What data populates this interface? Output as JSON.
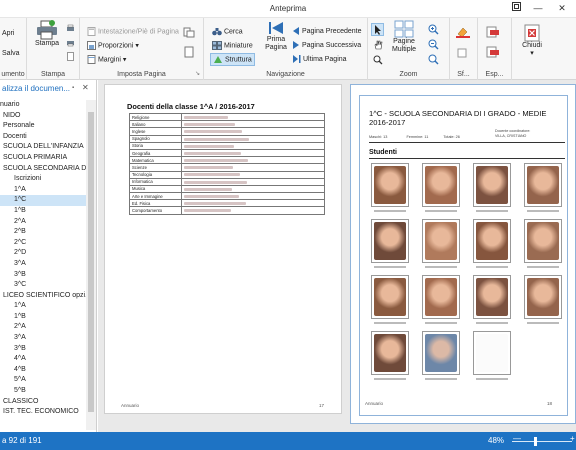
{
  "window": {
    "title": "Anteprima",
    "restore_icon": "restore-icon",
    "minimize": "—",
    "close": "✕"
  },
  "ribbon": {
    "documento": {
      "apri": "Apri",
      "salva": "Salva",
      "label": "umento"
    },
    "stampa": {
      "stampa": "Stampa",
      "label": "Stampa"
    },
    "imposta": {
      "intestazione": "Intestazione/Piè di Pagina",
      "proporzioni": "Proporzioni",
      "margini": "Margini",
      "label": "Imposta Pagina"
    },
    "navigazione": {
      "cerca": "Cerca",
      "miniature": "Miniature",
      "struttura": "Struttura",
      "prima_pagina": "Prima\nPagina",
      "pagina_precedente": "Pagina Precedente",
      "pagina_successiva": "Pagina Successiva",
      "ultima_pagina": "Ultima Pagina",
      "label": "Navigazione"
    },
    "zoom": {
      "pagine_multiple": "Pagine\nMultiple",
      "label": "Zoom"
    },
    "sf": {
      "label": "Sf..."
    },
    "esp": {
      "label": "Esp..."
    },
    "chiudi": {
      "chiudi": "Chiudi"
    }
  },
  "sidebar": {
    "title": "alizza il documen...",
    "items": [
      {
        "label": "nuario",
        "indent": 0
      },
      {
        "label": "NIDO",
        "indent": 1
      },
      {
        "label": "Personale",
        "indent": 1
      },
      {
        "label": "Docenti",
        "indent": 1
      },
      {
        "label": "SCUOLA DELL'INFANZIA",
        "indent": 1
      },
      {
        "label": "SCUOLA PRIMARIA",
        "indent": 1
      },
      {
        "label": "SCUOLA SECONDARIA D...",
        "indent": 1
      },
      {
        "label": "Iscrizioni",
        "indent": 2
      },
      {
        "label": "1^A",
        "indent": 2
      },
      {
        "label": "1^C",
        "indent": 2,
        "selected": true
      },
      {
        "label": "1^B",
        "indent": 2
      },
      {
        "label": "2^A",
        "indent": 2
      },
      {
        "label": "2^B",
        "indent": 2
      },
      {
        "label": "2^C",
        "indent": 2
      },
      {
        "label": "2^D",
        "indent": 2
      },
      {
        "label": "3^A",
        "indent": 2
      },
      {
        "label": "3^B",
        "indent": 2
      },
      {
        "label": "3^C",
        "indent": 2
      },
      {
        "label": "LICEO SCIENTIFICO opzi...",
        "indent": 1
      },
      {
        "label": "1^A",
        "indent": 2
      },
      {
        "label": "1^B",
        "indent": 2
      },
      {
        "label": "2^A",
        "indent": 2
      },
      {
        "label": "3^A",
        "indent": 2
      },
      {
        "label": "3^B",
        "indent": 2
      },
      {
        "label": "4^A",
        "indent": 2
      },
      {
        "label": "4^B",
        "indent": 2
      },
      {
        "label": "5^A",
        "indent": 2
      },
      {
        "label": "5^B",
        "indent": 2
      },
      {
        "label": "CLASSICO",
        "indent": 1
      },
      {
        "label": "IST. TEC. ECONOMICO",
        "indent": 1
      }
    ]
  },
  "page1": {
    "title": "Docenti della classe 1^A / 2016-2017",
    "subjects": [
      "Religione",
      "Italiano",
      "Inglese",
      "Spagnolo",
      "Storia",
      "Geografia",
      "Matematica",
      "Scienze",
      "Tecnologia",
      "Informatica",
      "Musica",
      "Arte e Immagine",
      "Ed. Fisica",
      "Comportamento"
    ],
    "footer_left": "Annuario",
    "footer_right": "17"
  },
  "page2": {
    "title_line1": "1^C - SCUOLA SECONDARIA DI I GRADO - MEDIE",
    "title_line2": "2016-2017",
    "maschi": "Maschi: 13",
    "femmine": "Femmine: 11",
    "totale": "Totale: 26",
    "coordinatore_label": "Docente coordinatore:",
    "coordinatore": "VILLA, CRISTIANO",
    "section": "Studenti",
    "footer_left": "Annuario",
    "footer_right": "18"
  },
  "status": {
    "page": "a 92 di 191",
    "zoom": "48%",
    "minus": "—",
    "plus": "+"
  }
}
